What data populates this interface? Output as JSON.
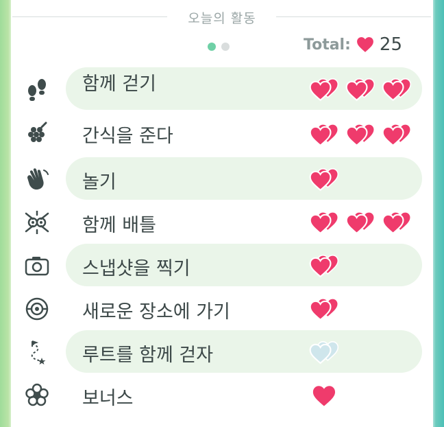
{
  "header": {
    "title": "오늘의 활동",
    "total_label": "Total:",
    "total_value": "25",
    "total_icon": "heart-icon"
  },
  "pager": {
    "pages": 2,
    "active": 0,
    "active_color": "#6fd0a6",
    "inactive_color": "#d9dddd"
  },
  "colors": {
    "heart_red": "#ef3b6c",
    "heart_faded": "#cfe6ec",
    "pill_bg": "#eaf5e9"
  },
  "activities": [
    {
      "label": "함께 걷기",
      "icon": "footprints-icon",
      "hearts": 3,
      "state": "earned"
    },
    {
      "label": "간식을 준다",
      "icon": "berry-icon",
      "hearts": 3,
      "state": "earned"
    },
    {
      "label": "놀기",
      "icon": "waving-hand-icon",
      "hearts": 1,
      "state": "earned"
    },
    {
      "label": "함께 배틀",
      "icon": "battle-icon",
      "hearts": 3,
      "state": "earned"
    },
    {
      "label": "스냅샷을 찍기",
      "icon": "camera-icon",
      "hearts": 1,
      "state": "earned"
    },
    {
      "label": "새로운 장소에 가기",
      "icon": "pokestop-icon",
      "hearts": 1,
      "state": "earned"
    },
    {
      "label": "루트를 함께 걷자",
      "icon": "route-icon",
      "hearts": 1,
      "state": "not-earned"
    },
    {
      "label": "보너스",
      "icon": "flower-icon",
      "hearts": 1,
      "state": "single"
    }
  ]
}
